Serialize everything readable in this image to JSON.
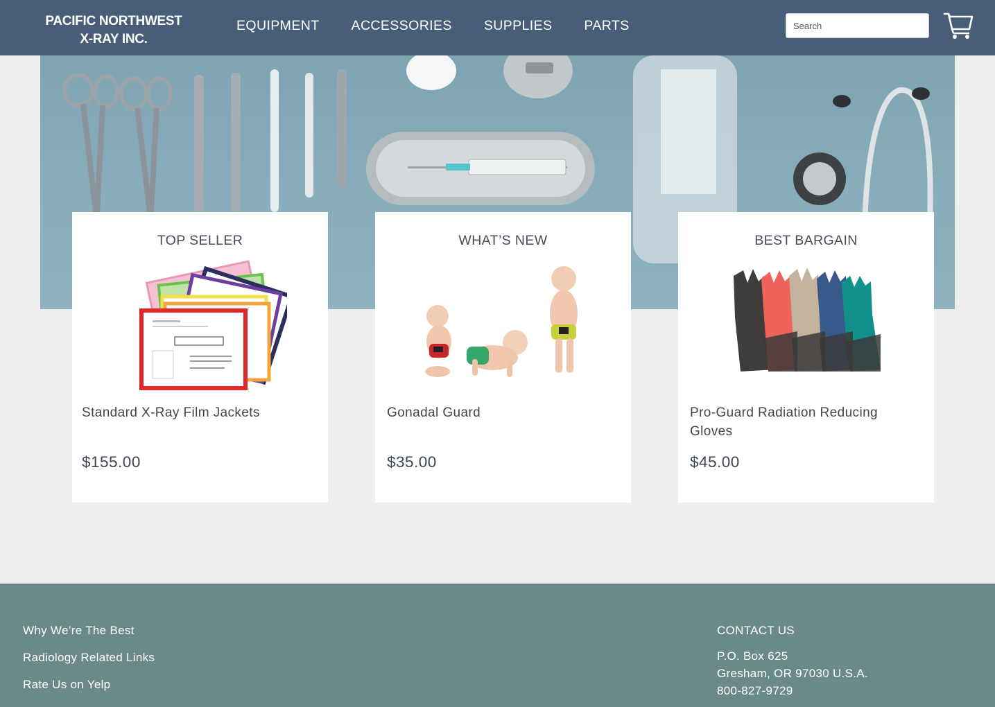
{
  "header": {
    "logo_line1": "PACIFIC NORTHWEST",
    "logo_line2": "X-RAY INC.",
    "nav": [
      "EQUIPMENT",
      "ACCESSORIES",
      "SUPPLIES",
      "PARTS"
    ],
    "search_placeholder": "Search",
    "cart_icon": "shopping-cart-icon"
  },
  "colors": {
    "header_bg": "#485e78",
    "footer_bg": "#6a8a8a",
    "page_bg": "#eeeeee",
    "hero_bg": "#85a9b7"
  },
  "cards": [
    {
      "heading": "TOP SELLER",
      "title": "Standard X-Ray Film Jackets",
      "price": "$155.00",
      "image": "film-jackets-image"
    },
    {
      "heading": "WHAT’S NEW",
      "title": "Gonadal Guard",
      "price": "$35.00",
      "image": "gonadal-guard-image"
    },
    {
      "heading": "BEST BARGAIN",
      "title": "Pro-Guard Radiation Reducing Gloves",
      "price": "$45.00",
      "image": "radiation-gloves-image"
    }
  ],
  "footer": {
    "links": [
      "Why We’re The Best",
      "Radiology Related Links",
      "Rate Us on Yelp"
    ],
    "contact_heading": "CONTACT US",
    "contact_lines": [
      "P.O. Box 625",
      "Gresham, OR 97030 U.S.A.",
      "800-827-9729"
    ]
  }
}
